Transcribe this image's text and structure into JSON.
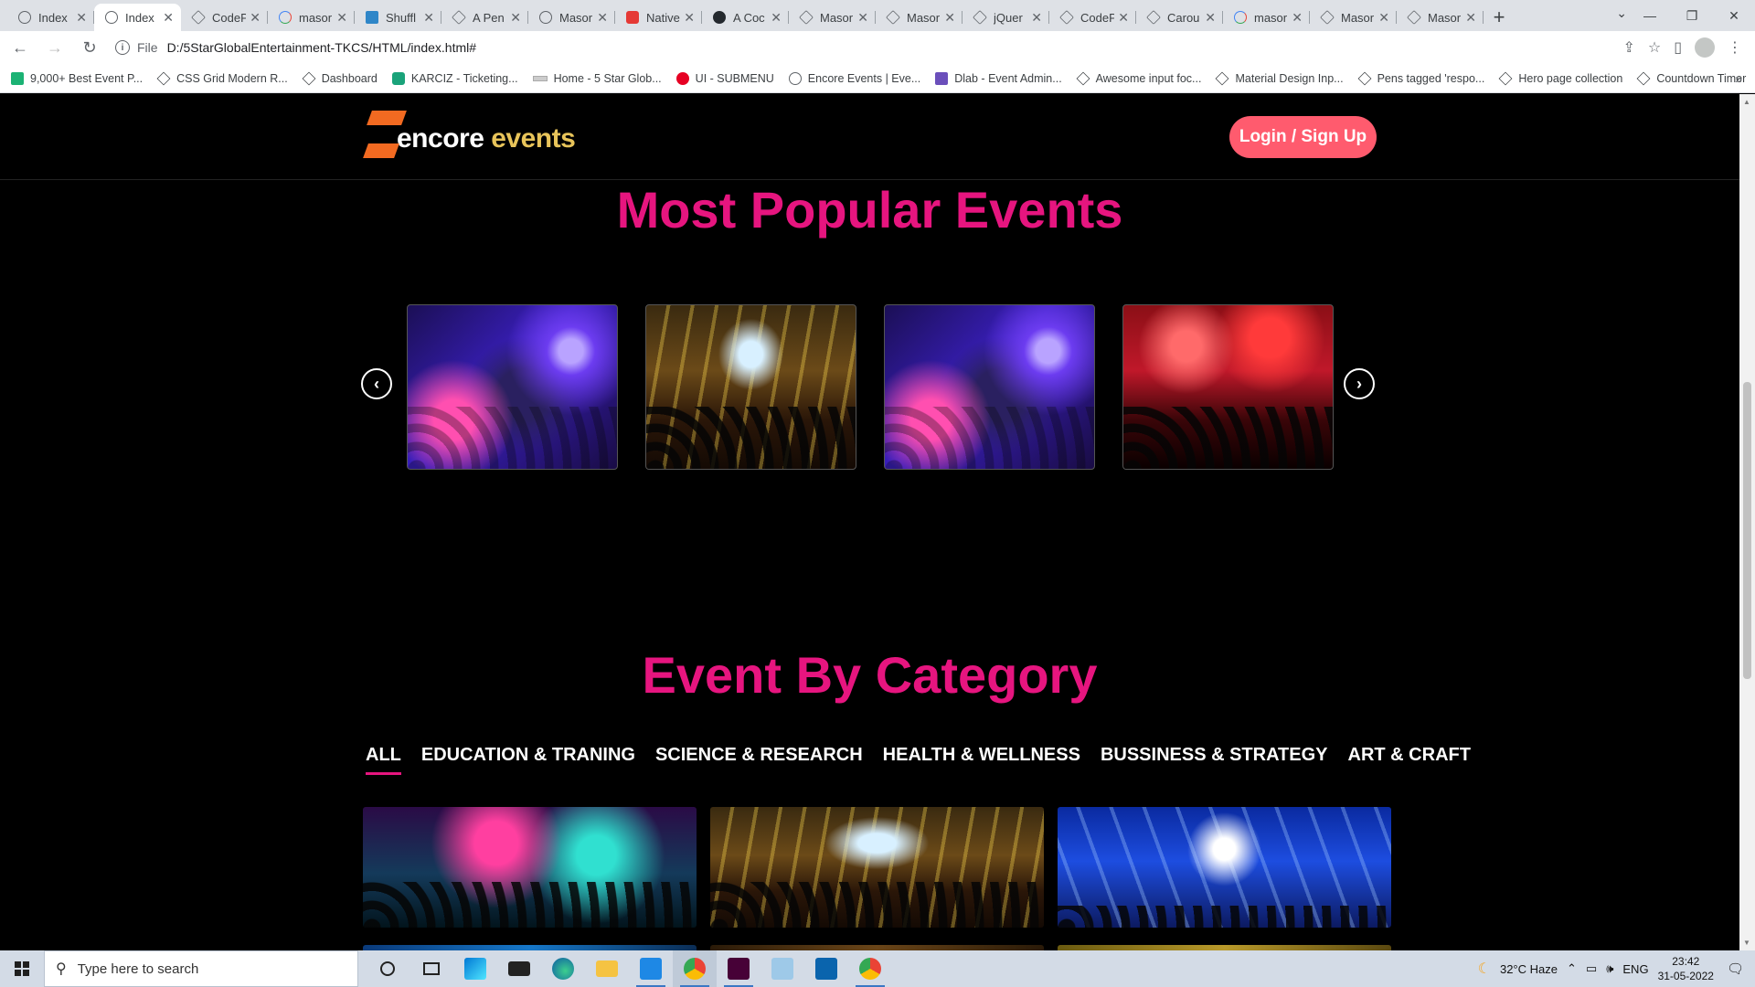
{
  "browser": {
    "tabs": [
      {
        "label": "Index",
        "icon": "globe-icon"
      },
      {
        "label": "Index",
        "icon": "globe-icon",
        "active": true
      },
      {
        "label": "CodeP",
        "icon": "codepen-icon"
      },
      {
        "label": "masor",
        "icon": "google-icon"
      },
      {
        "label": "Shuffl",
        "icon": "shuffle-icon"
      },
      {
        "label": "A Pen",
        "icon": "codepen-icon"
      },
      {
        "label": "Masor",
        "icon": "globe-icon"
      },
      {
        "label": "Native",
        "icon": "native-icon"
      },
      {
        "label": "A Coc",
        "icon": "github-icon"
      },
      {
        "label": "Masor",
        "icon": "codepen-icon"
      },
      {
        "label": "Masor",
        "icon": "codepen-icon"
      },
      {
        "label": "jQuer",
        "icon": "codepen-icon"
      },
      {
        "label": "CodeP",
        "icon": "codepen-icon"
      },
      {
        "label": "Carou",
        "icon": "codepen-icon"
      },
      {
        "label": "masor",
        "icon": "google-icon"
      },
      {
        "label": "Masor",
        "icon": "codepen-icon"
      },
      {
        "label": "Masor",
        "icon": "codepen-icon"
      }
    ],
    "close_glyph": "✕",
    "new_tab_glyph": "+",
    "url_scheme": "File",
    "url": "D:/5StarGlobalEntertainment-TKCS/HTML/index.html#",
    "bookmarks": [
      {
        "label": "9,000+ Best Event P...",
        "icon": "d"
      },
      {
        "label": "CSS Grid Modern R...",
        "icon": "cp"
      },
      {
        "label": "Dashboard",
        "icon": "cp"
      },
      {
        "label": "KARCIZ - Ticketing...",
        "icon": "k"
      },
      {
        "label": "Home - 5 Star Glob...",
        "icon": "s"
      },
      {
        "label": "UI - SUBMENU",
        "icon": "p"
      },
      {
        "label": "Encore Events | Eve...",
        "icon": "w"
      },
      {
        "label": "Dlab - Event Admin...",
        "icon": "c"
      },
      {
        "label": "Awesome input foc...",
        "icon": "cp"
      },
      {
        "label": "Material Design Inp...",
        "icon": "cp"
      },
      {
        "label": "Pens tagged 'respo...",
        "icon": "cp"
      },
      {
        "label": "Hero page collection",
        "icon": "cp"
      },
      {
        "label": "Countdown Timer",
        "icon": "cp"
      }
    ]
  },
  "site": {
    "logo_part1": "encore",
    "logo_part2": " events",
    "login_label": "Login / Sign Up",
    "popular_title": "Most Popular Events",
    "category_title": "Event By Category",
    "categories": [
      {
        "label": "ALL",
        "active": true
      },
      {
        "label": "EDUCATION & TRANING"
      },
      {
        "label": "SCIENCE & RESEARCH"
      },
      {
        "label": "HEALTH & WELLNESS"
      },
      {
        "label": "BUSSINESS & STRATEGY"
      },
      {
        "label": "ART & CRAFT"
      }
    ],
    "prev_glyph": "‹",
    "next_glyph": "›"
  },
  "taskbar": {
    "search_placeholder": "Type here to search",
    "weather": "32°C  Haze",
    "language": "ENG",
    "time": "23:42",
    "date": "31-05-2022"
  },
  "colors": {
    "accent_pink": "#e6157f",
    "login_button": "#ff5b6e",
    "logo_orange": "#f26a21"
  }
}
